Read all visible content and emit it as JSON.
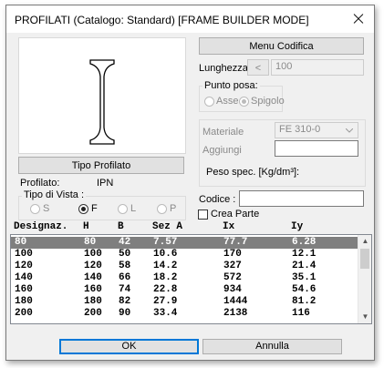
{
  "window": {
    "title": "PROFILATI (Catalogo: Standard) [FRAME BUILDER MODE]"
  },
  "buttons": {
    "menu_codifica": "Menu Codifica",
    "tipo_profilato": "Tipo Profilato",
    "ok": "OK",
    "annulla": "Annulla",
    "lunghezza_stepper": "<"
  },
  "lunghezza": {
    "label": "Lunghezza",
    "value": "100"
  },
  "punto_posa": {
    "label": "Punto posa:",
    "options": [
      "Asse",
      "Spigolo"
    ],
    "selected": "Spigolo"
  },
  "materiale": {
    "label": "Materiale",
    "value": "FE 310-0"
  },
  "aggiungi": {
    "label": "Aggiungi",
    "value": ""
  },
  "peso_spec": {
    "label": "Peso spec. [Kg/dm³]:"
  },
  "profilato": {
    "label": "Profilato:",
    "value": "IPN"
  },
  "tipo_vista": {
    "label": "Tipo di Vista :",
    "options": [
      "S",
      "F",
      "L",
      "P"
    ],
    "selected": "F"
  },
  "codice": {
    "label": "Codice :",
    "value": ""
  },
  "crea_parte": {
    "label": "Crea Parte",
    "checked": false
  },
  "table": {
    "headers": [
      "Designaz.",
      "H",
      "B",
      "Sez A",
      "Ix",
      "Iy"
    ],
    "rows": [
      [
        "80",
        "80",
        "42",
        "7.57",
        "77.7",
        "6.28"
      ],
      [
        "100",
        "100",
        "50",
        "10.6",
        "170",
        "12.1"
      ],
      [
        "120",
        "120",
        "58",
        "14.2",
        "327",
        "21.4"
      ],
      [
        "140",
        "140",
        "66",
        "18.2",
        "572",
        "35.1"
      ],
      [
        "160",
        "160",
        "74",
        "22.8",
        "934",
        "54.6"
      ],
      [
        "180",
        "180",
        "82",
        "27.9",
        "1444",
        "81.2"
      ],
      [
        "200",
        "200",
        "90",
        "33.4",
        "2138",
        "116"
      ]
    ],
    "selected_row": 0
  },
  "icons": {
    "close": "close-icon",
    "profile": "i-beam-profile-icon",
    "dropdown": "chevron-down-icon",
    "scroll_up": "scroll-up-icon",
    "scroll_down": "scroll-down-icon"
  }
}
